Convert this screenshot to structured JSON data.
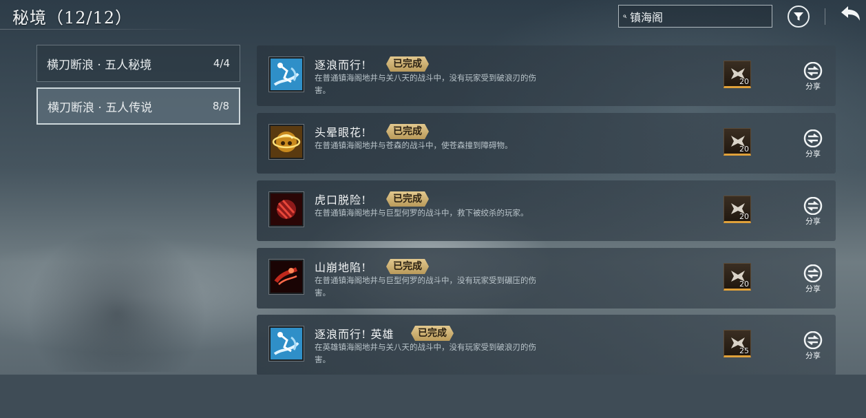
{
  "header": {
    "title": "秘境（12/12）",
    "search": {
      "value": "镇海阁",
      "placeholder": ""
    }
  },
  "categories": [
    {
      "label": "横刀断浪 · 五人秘境",
      "count": "4/4",
      "active": false
    },
    {
      "label": "横刀断浪 · 五人传说",
      "count": "8/8",
      "active": true
    }
  ],
  "achievements": [
    {
      "title": "逐浪而行!",
      "status": "已完成",
      "desc": "在普通镇海阁地井与关八天的战斗中，没有玩家受到破浪刃的伤害。",
      "reward": "20",
      "share": "分享",
      "icon": "wave-warrior-icon"
    },
    {
      "title": "头晕眼花!",
      "status": "已完成",
      "desc": "在普通镇海阁地井与苍森的战斗中，使苍森撞到障碍物。",
      "reward": "20",
      "share": "分享",
      "icon": "dizzy-golden-icon"
    },
    {
      "title": "虎口脱险!",
      "status": "已完成",
      "desc": "在普通镇海阁地井与巨型何罗的战斗中，救下被绞杀的玩家。",
      "reward": "20",
      "share": "分享",
      "icon": "red-claw-icon"
    },
    {
      "title": "山崩地陷!",
      "status": "已完成",
      "desc": "在普通镇海阁地井与巨型何罗的战斗中，没有玩家受到碾压的伤害。",
      "reward": "20",
      "share": "分享",
      "icon": "red-crush-icon"
    },
    {
      "title": "逐浪而行! 英雄",
      "status": "已完成",
      "desc": "在英雄镇海阁地井与关八天的战斗中，没有玩家受到破浪刃的伤害。",
      "reward": "25",
      "share": "分享",
      "icon": "wave-warrior-icon"
    }
  ],
  "colors": {
    "badge_gold": "#d6bb7c",
    "reward_bar": "#e0a13a",
    "panel_dark": "#2a3640"
  }
}
